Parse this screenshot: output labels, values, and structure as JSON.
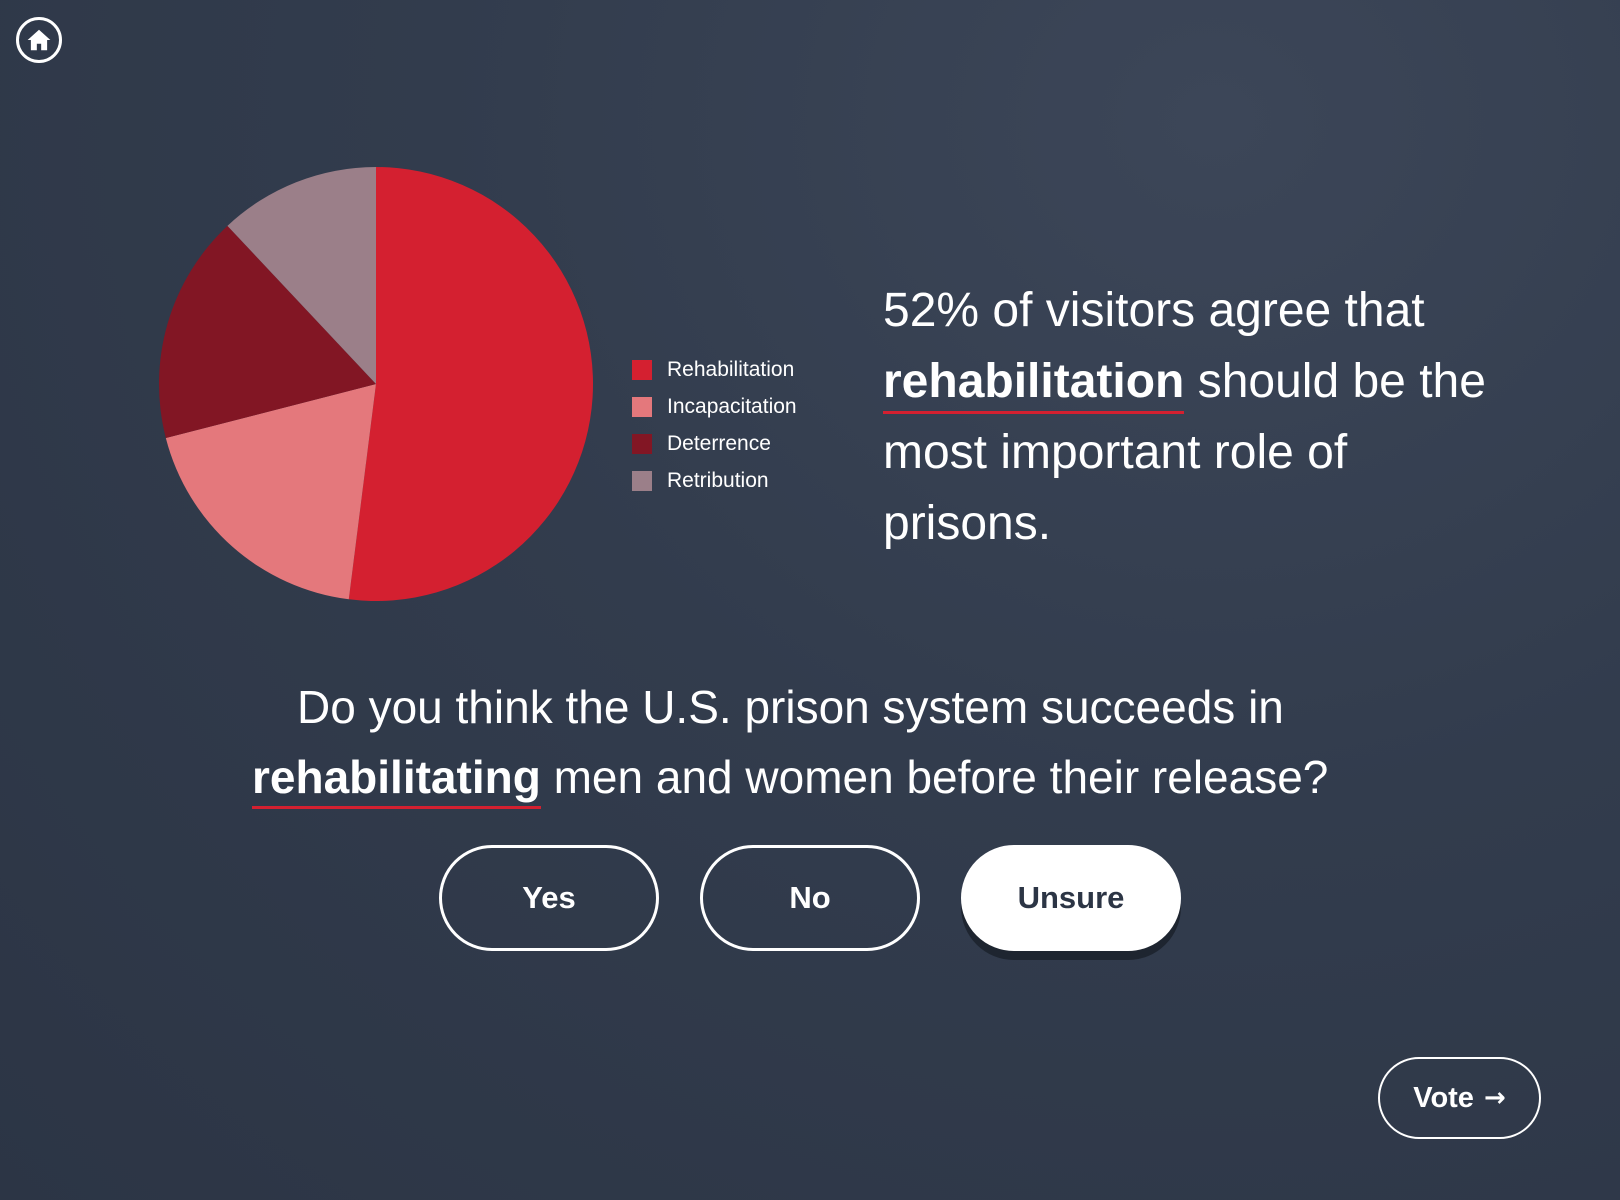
{
  "home": {
    "icon": "home-icon"
  },
  "chart_data": {
    "type": "pie",
    "labels": [
      "Rehabilitation",
      "Incapacitation",
      "Deterrence",
      "Retribution"
    ],
    "values": [
      52,
      19,
      17,
      12
    ],
    "colors": [
      "#d42030",
      "#e4787c",
      "#821624",
      "#9b7f89"
    ]
  },
  "stat": {
    "line1": "52% of visitors agree that",
    "highlight": "rehabilitation",
    "line2_rest": " should be the",
    "line3": "most important role of",
    "line4": "prisons."
  },
  "question": {
    "line1": "Do you think the U.S. prison system succeeds in",
    "highlight": "rehabilitating",
    "line2_rest": " men and women before their release?"
  },
  "answers": {
    "yes": "Yes",
    "no": "No",
    "unsure": "Unsure",
    "selected": "Unsure"
  },
  "vote": {
    "label": "Vote",
    "arrow": "→"
  }
}
